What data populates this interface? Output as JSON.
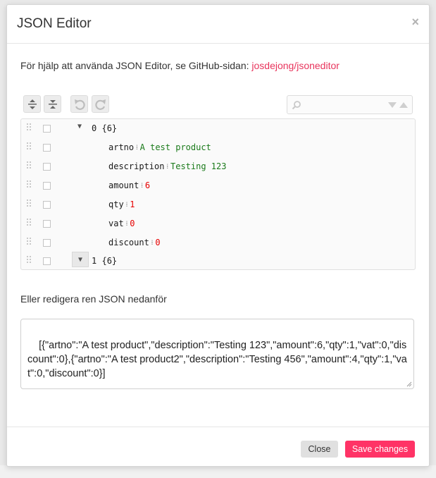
{
  "modal": {
    "title": "JSON Editor",
    "close_glyph": "×",
    "help_text": "För hjälp att använda JSON Editor, se GitHub-sidan:",
    "help_link": "josdejong/jsoneditor"
  },
  "toolbar": {
    "icons": [
      "expand-all-icon",
      "collapse-all-icon",
      "undo-icon",
      "redo-icon"
    ],
    "search_placeholder": ""
  },
  "tree": {
    "root0": {
      "index": "0",
      "count": "{6}"
    },
    "fields": [
      {
        "key": "artno",
        "value": "A test product",
        "kind": "string"
      },
      {
        "key": "description",
        "value": "Testing 123",
        "kind": "string"
      },
      {
        "key": "amount",
        "value": "6",
        "kind": "number"
      },
      {
        "key": "qty",
        "value": "1",
        "kind": "number"
      },
      {
        "key": "vat",
        "value": "0",
        "kind": "number"
      },
      {
        "key": "discount",
        "value": "0",
        "kind": "number"
      }
    ],
    "root1": {
      "index": "1",
      "count": "{6}"
    }
  },
  "raw": {
    "label": "Eller redigera ren JSON nedanför",
    "value": "[{\"artno\":\"A test product\",\"description\":\"Testing 123\",\"amount\":6,\"qty\":1,\"vat\":0,\"discount\":0},{\"artno\":\"A test product2\",\"description\":\"Testing 456\",\"amount\":4,\"qty\":1,\"vat\":0,\"discount\":0}]"
  },
  "footer": {
    "close_label": "Close",
    "save_label": "Save changes"
  },
  "colors": {
    "accent": "#ff3366",
    "link": "#e8345c",
    "string_value": "#1a7a1a",
    "number_value": "#e60000"
  }
}
